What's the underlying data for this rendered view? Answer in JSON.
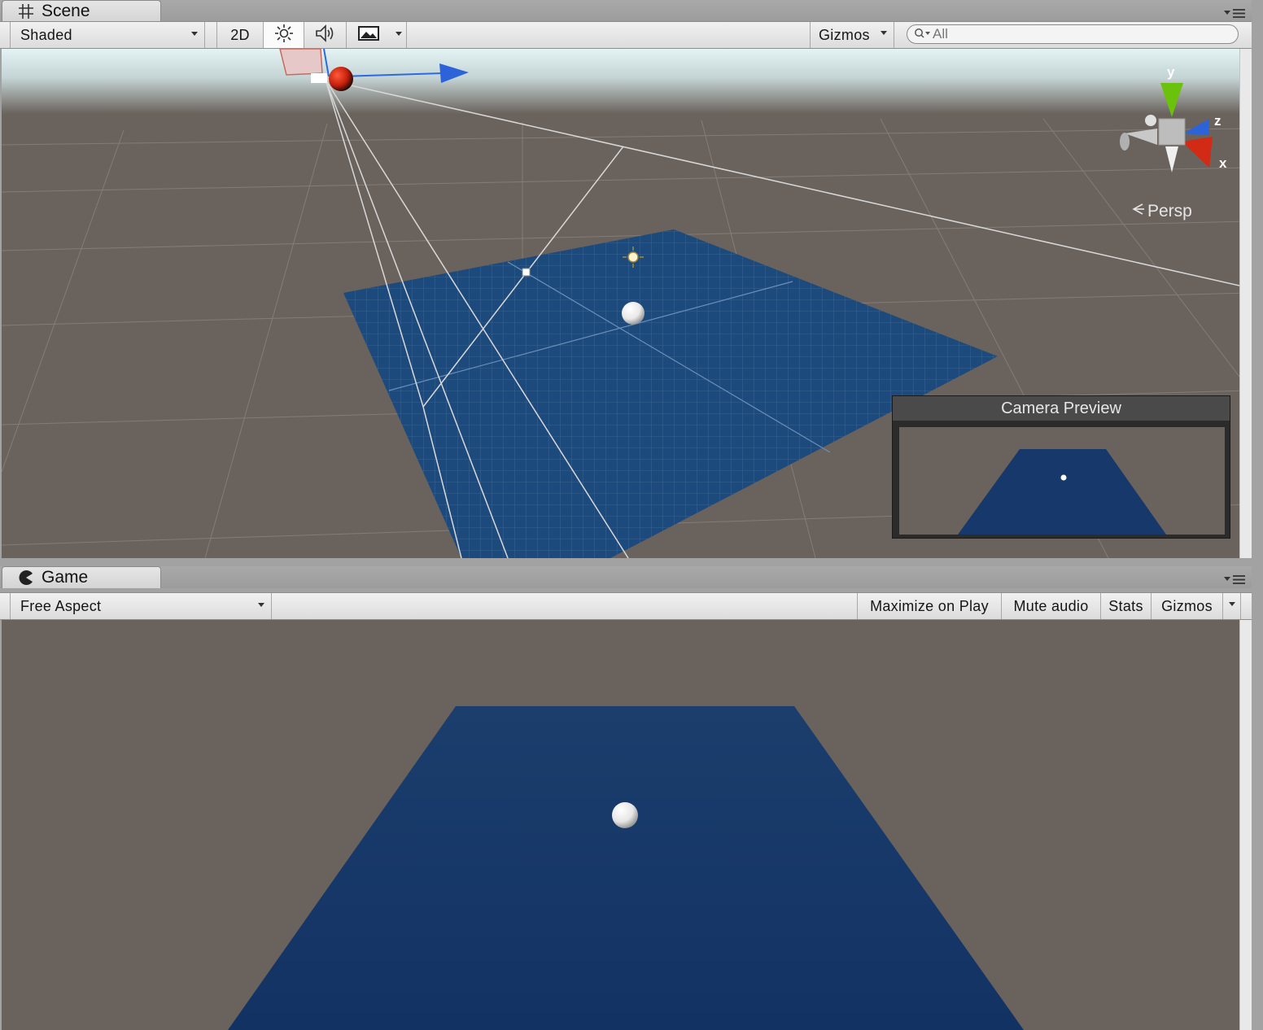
{
  "scene_panel": {
    "tab_title": "Scene",
    "tab_icon": "grid-icon",
    "toolbar": {
      "draw_mode": "Shaded",
      "mode_2d": "2D",
      "lighting_icon": "sun-icon",
      "audio_icon": "speaker-icon",
      "effects_icon": "image-icon",
      "gizmos": "Gizmos",
      "search_placeholder": "All"
    },
    "orientation_gizmo": {
      "axis_y": "y",
      "axis_z": "z",
      "axis_x": "x",
      "projection": "Persp"
    },
    "camera_preview": {
      "title": "Camera Preview"
    },
    "colors": {
      "ground": "#6a625d",
      "plane": "#1d4a7c",
      "sky": "#e3f2f2"
    }
  },
  "game_panel": {
    "tab_title": "Game",
    "tab_icon": "pacman-icon",
    "toolbar": {
      "aspect": "Free Aspect",
      "maximize_on_play": "Maximize on Play",
      "mute_audio": "Mute audio",
      "stats": "Stats",
      "gizmos": "Gizmos"
    },
    "colors": {
      "background": "#6a625d",
      "plane": "#17386a"
    }
  }
}
